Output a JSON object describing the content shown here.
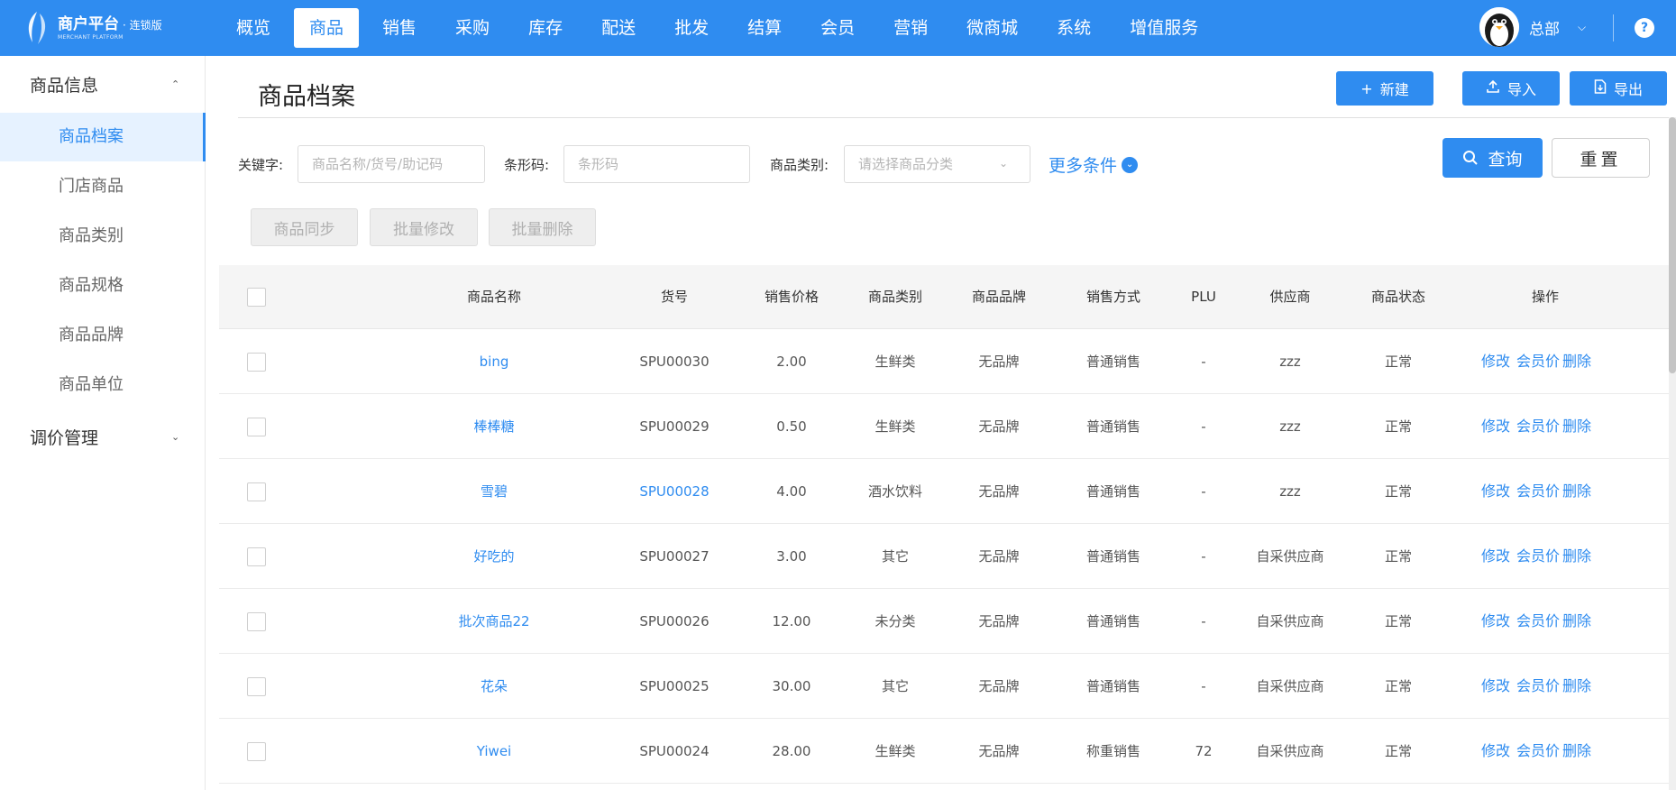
{
  "brand": {
    "title": "商户平台",
    "edition": "· 连锁版",
    "subtitle": "MERCHANT PLATFORM"
  },
  "nav": {
    "items": [
      "概览",
      "商品",
      "销售",
      "采购",
      "库存",
      "配送",
      "批发",
      "结算",
      "会员",
      "营销",
      "微商城",
      "系统",
      "增值服务"
    ],
    "active_index": 1
  },
  "user": {
    "name": "总部",
    "caret_icon": "chevron-down-icon",
    "help_label": "?"
  },
  "sidebar": {
    "group1": "商品信息",
    "items": [
      "商品档案",
      "门店商品",
      "商品类别",
      "商品规格",
      "商品品牌",
      "商品单位"
    ],
    "active_index": 0,
    "group2": "调价管理"
  },
  "page": {
    "title": "商品档案"
  },
  "toolbar": {
    "new_label": "新建",
    "import_label": "导入",
    "export_label": "导出"
  },
  "filters": {
    "keyword_label": "关键字:",
    "keyword_placeholder": "商品名称/货号/助记码",
    "barcode_label": "条形码:",
    "barcode_placeholder": "条形码",
    "category_label": "商品类别:",
    "category_placeholder": "请选择商品分类",
    "more_label": "更多条件",
    "query_label": "查询",
    "reset_label": "重置"
  },
  "batch": {
    "sync_label": "商品同步",
    "edit_label": "批量修改",
    "delete_label": "批量删除"
  },
  "table": {
    "headers": {
      "name": "商品名称",
      "code": "货号",
      "price": "销售价格",
      "category": "商品类别",
      "brand": "商品品牌",
      "sale_mode": "销售方式",
      "plu": "PLU",
      "supplier": "供应商",
      "status": "商品状态",
      "ops": "操作"
    },
    "op_labels": {
      "edit": "修改",
      "member_price": "会员价",
      "delete": "删除"
    },
    "rows": [
      {
        "name": "bing",
        "code": "SPU00030",
        "price": "2.00",
        "category": "生鲜类",
        "brand": "无品牌",
        "sale_mode": "普通销售",
        "plu": "-",
        "supplier": "zzz",
        "status": "正常",
        "code_link": false
      },
      {
        "name": "棒棒糖",
        "code": "SPU00029",
        "price": "0.50",
        "category": "生鲜类",
        "brand": "无品牌",
        "sale_mode": "普通销售",
        "plu": "-",
        "supplier": "zzz",
        "status": "正常",
        "code_link": false
      },
      {
        "name": "雪碧",
        "code": "SPU00028",
        "price": "4.00",
        "category": "酒水饮料",
        "brand": "无品牌",
        "sale_mode": "普通销售",
        "plu": "-",
        "supplier": "zzz",
        "status": "正常",
        "code_link": true
      },
      {
        "name": "好吃的",
        "code": "SPU00027",
        "price": "3.00",
        "category": "其它",
        "brand": "无品牌",
        "sale_mode": "普通销售",
        "plu": "-",
        "supplier": "自采供应商",
        "status": "正常",
        "code_link": false
      },
      {
        "name": "批次商品22",
        "code": "SPU00026",
        "price": "12.00",
        "category": "未分类",
        "brand": "无品牌",
        "sale_mode": "普通销售",
        "plu": "-",
        "supplier": "自采供应商",
        "status": "正常",
        "code_link": false
      },
      {
        "name": "花朵",
        "code": "SPU00025",
        "price": "30.00",
        "category": "其它",
        "brand": "无品牌",
        "sale_mode": "普通销售",
        "plu": "-",
        "supplier": "自采供应商",
        "status": "正常",
        "code_link": false
      },
      {
        "name": "Yiwei",
        "code": "SPU00024",
        "price": "28.00",
        "category": "生鲜类",
        "brand": "无品牌",
        "sale_mode": "称重销售",
        "plu": "72",
        "supplier": "自采供应商",
        "status": "正常",
        "code_link": false
      }
    ]
  },
  "colors": {
    "primary": "#2f8cf0",
    "sidebar_active_bg": "#e6f2ff",
    "disabled_bg": "#eeeeee"
  }
}
